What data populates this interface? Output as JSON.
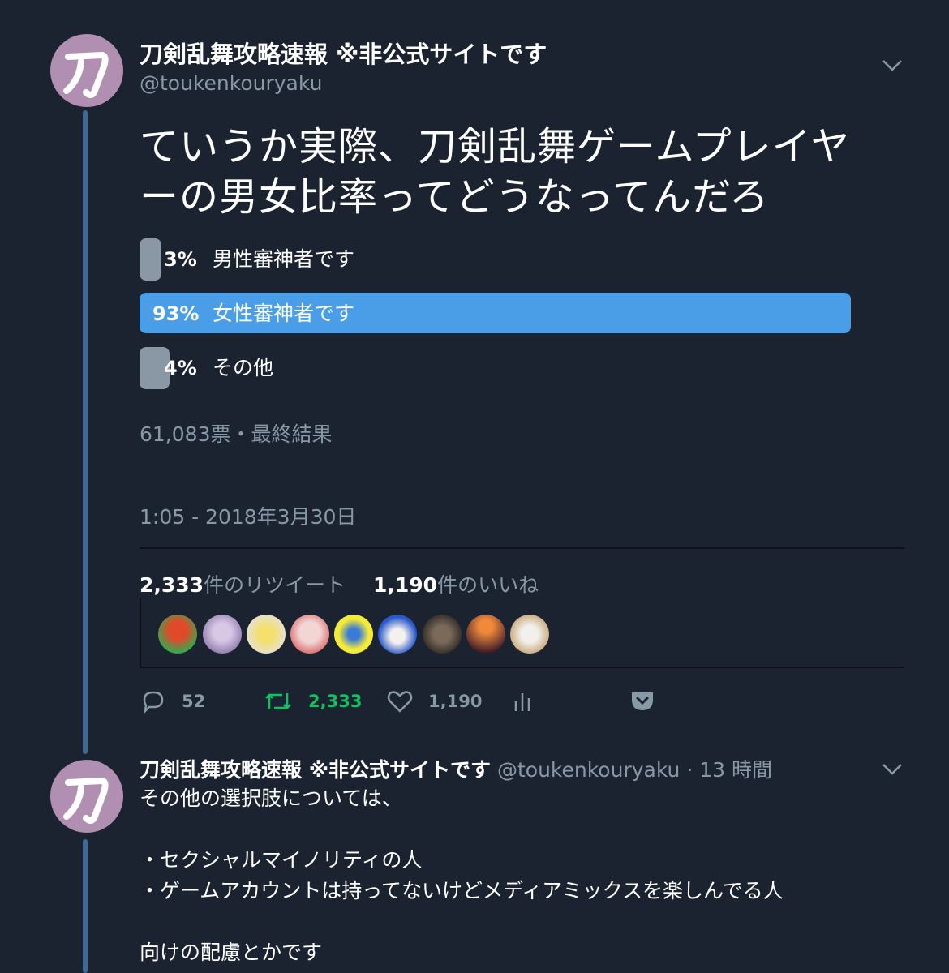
{
  "tweet": {
    "author_name": "刀剣乱舞攻略速報 ※非公式サイトです",
    "author_handle": "@toukenkouryaku",
    "avatar_char": "刀",
    "text_line1": "ていうか実際、刀剣乱舞ゲームプレイヤ",
    "text_line2": "ーの男女比率ってどうなってんだろ",
    "poll": {
      "options": [
        {
          "pct_label": "3%",
          "label": "男性審神者です",
          "value": 0.03
        },
        {
          "pct_label": "93%",
          "label": "女性審神者です",
          "value": 0.93
        },
        {
          "pct_label": "4%",
          "label": "その他",
          "value": 0.04
        }
      ],
      "summary": "61,083票・最終結果"
    },
    "timestamp": "1:05 - 2018年3月30日",
    "stats": {
      "retweets_count": "2,333",
      "retweets_label": "件のリツイート",
      "likes_count": "1,190",
      "likes_label": "件のいいね"
    },
    "actions": {
      "reply_count": "52",
      "retweet_count": "2,333",
      "like_count": "1,190"
    }
  },
  "reply": {
    "author_name": "刀剣乱舞攻略速報 ※非公式サイトです",
    "author_handle": "@toukenkouryaku",
    "time": "· 13 時間",
    "avatar_char": "刀",
    "line1": "その他の選択肢については、",
    "line2": "・セクシャルマイノリティの人",
    "line3": "・ゲームアカウントは持ってないけどメディアミックスを楽しんでる人",
    "line4": "向けの配慮とかです"
  },
  "colors": {
    "background": "#1b2330",
    "poll_winner": "#4a9ee8",
    "poll_other": "#8a98a6",
    "retweet_green": "#17bf63",
    "muted": "#8899a6",
    "avatar": "#b18fb2",
    "thread_line": "#3c6c95"
  }
}
